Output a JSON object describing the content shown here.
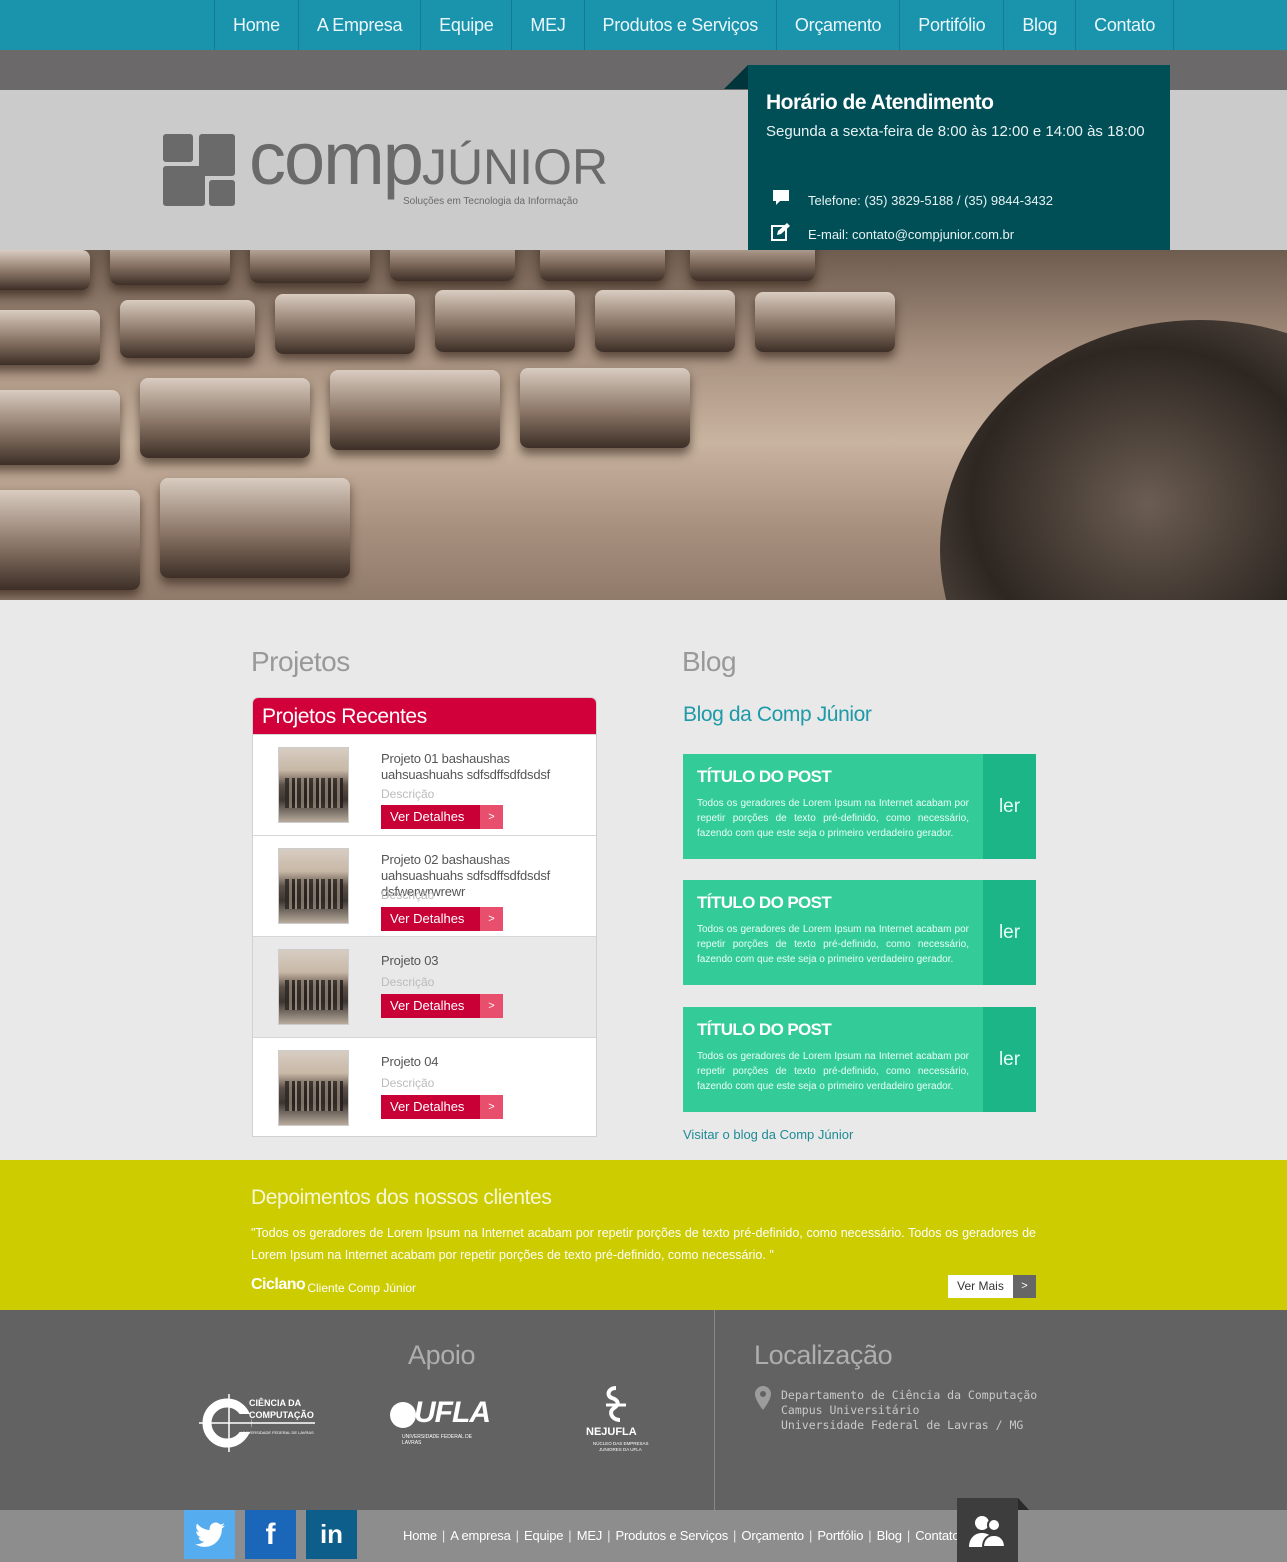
{
  "nav": {
    "items": [
      "Home",
      "A Empresa",
      "Equipe",
      "MEJ",
      "Produtos e Serviços",
      "Orçamento",
      "Portifólio",
      "Blog",
      "Contato"
    ]
  },
  "logo": {
    "word": "comp",
    "junior": "JÚNIOR",
    "tagline": "Soluções em Tecnologia da Informação"
  },
  "hours": {
    "title": "Horário de Atendimento",
    "schedule": "Segunda a sexta-feira de 8:00 às 12:00 e 14:00 às 18:00",
    "phone": "Telefone: (35) 3829-5188 / (35) 9844-3432",
    "email": "E-mail: contato@compjunior.com.br",
    "phone_icon": "chat-bubble-icon",
    "email_icon": "edit-icon"
  },
  "projects": {
    "section_title": "Projetos",
    "panel_title": "Projetos Recentes",
    "button_label": "Ver Detalhes",
    "button_arrow": ">",
    "description_label": "Descrição",
    "items": [
      {
        "name": "Projeto 01 bashaushas uahsuashuahs sdfsdffsdfdsdsf"
      },
      {
        "name": "Projeto 02 bashaushas uahsuashuahs sdfsdffsdfdsdsf dsfwerwrwrewr"
      },
      {
        "name": "Projeto 03"
      },
      {
        "name": "Projeto 04"
      }
    ]
  },
  "blog": {
    "section_title": "Blog",
    "subtitle": "Blog da Comp Júnior",
    "read_label": "ler",
    "posts": [
      {
        "title": "TÍTULO DO POST",
        "text": "Todos os geradores de Lorem Ipsum na Internet acabam por repetir porções de texto pré-definido, como necessário, fazendo com que este seja o primeiro verdadeiro gerador."
      },
      {
        "title": "TÍTULO DO POST",
        "text": "Todos os geradores de Lorem Ipsum na Internet acabam por repetir porções de texto pré-definido, como necessário, fazendo com que este seja o primeiro verdadeiro gerador."
      },
      {
        "title": "TÍTULO DO POST",
        "text": "Todos os geradores de Lorem Ipsum na Internet acabam por repetir porções de texto pré-definido, como necessário, fazendo com que este seja o primeiro verdadeiro gerador."
      }
    ],
    "visit_link": "Visitar o blog da Comp Júnior"
  },
  "testimonials": {
    "title": "Depoimentos dos nossos clientes",
    "quote": "\"Todos os geradores de Lorem Ipsum na Internet acabam por repetir porções de texto pré-definido, como necessário. Todos os geradores de Lorem Ipsum na Internet acabam por repetir porções de texto pré-definido, como necessário. \"",
    "author": "Ciclano",
    "role": "- Cliente Comp Júnior",
    "more_label": "Ver Mais",
    "more_arrow": ">"
  },
  "footer": {
    "support_title": "Apoio",
    "location_title": "Localização",
    "location_lines": [
      "Departamento de Ciência da Computação",
      "Campus Universitário",
      "Universidade Federal de Lavras / MG"
    ],
    "supporters": [
      {
        "line1": "CIÊNCIA DA",
        "line2": "COMPUTAÇÃO",
        "line3": "UNIVERSIDADE FEDERAL DE LAVRAS"
      },
      {
        "line1": "UFLA",
        "line2": "UNIVERSIDADE FEDERAL DE LAVRAS"
      },
      {
        "line1": "NEJUFLA",
        "line2": "NÚCLEO DAS EMPRESAS",
        "line3": "JUNIORES DA UFLA"
      }
    ]
  },
  "bottom": {
    "social": [
      "twitter-icon",
      "facebook-icon",
      "linkedin-icon"
    ],
    "twitter_color": "#55acee",
    "facebook_color": "#1a66b8",
    "linkedin_color": "#0e5e8c",
    "nav": [
      "Home",
      "A empresa",
      "Equipe",
      "MEJ",
      "Produtos e Serviços",
      "Orçamento",
      "Portfólio",
      "Blog",
      "Contato"
    ]
  },
  "colors": {
    "nav_bg": "#1a93ad",
    "hours_bg": "#004f57",
    "projects_red": "#d2003a",
    "blog_green": "#33cc99",
    "testimonial_yellow": "#cccc00",
    "footer_gray": "#636262"
  }
}
